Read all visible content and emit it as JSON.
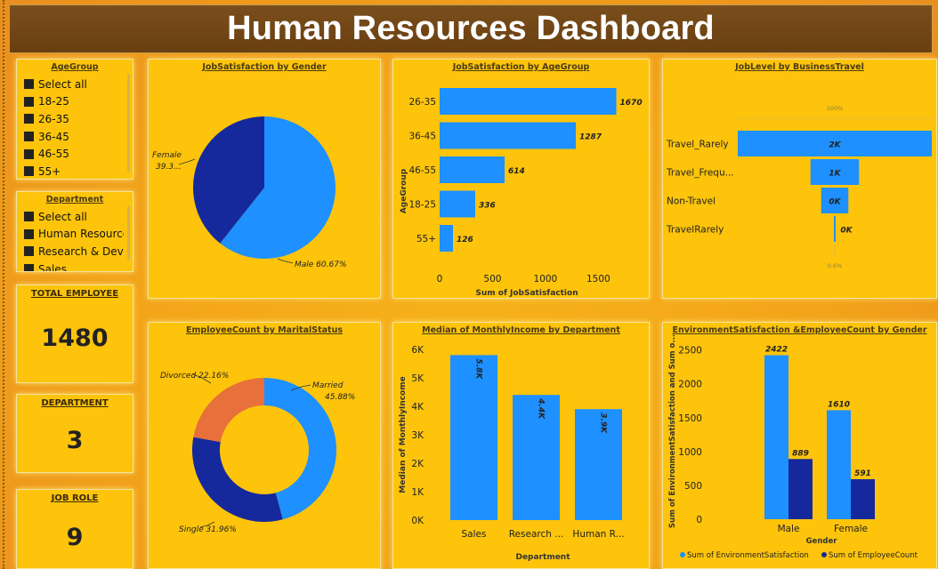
{
  "header": {
    "title": "Human Resources Dashboard"
  },
  "colors": {
    "blue": "#1e90ff",
    "navy": "#15299c",
    "orange": "#e8703a",
    "panel": "#fdc40b",
    "header": "#6e4416"
  },
  "slicers": {
    "age_group": {
      "title": "AgeGroup",
      "items": [
        "Select all",
        "18-25",
        "26-35",
        "36-45",
        "46-55",
        "55+"
      ]
    },
    "department": {
      "title": "Department",
      "items": [
        "Select all",
        "Human Resources",
        "Research & Deve...",
        "Sales"
      ]
    }
  },
  "cards": {
    "total_employee": {
      "title": "TOTAL EMPLOYEE",
      "value": "1480"
    },
    "department": {
      "title": "DEPARTMENT",
      "value": "3"
    },
    "job_role": {
      "title": "JOB ROLE",
      "value": "9"
    }
  },
  "chart_data": [
    {
      "id": "job_sat_gender",
      "type": "pie",
      "title": "JobSatisfaction by Gender",
      "slices": [
        {
          "name": "Male",
          "value": 60.67,
          "label": "Male 60.67%",
          "color": "#1e90ff"
        },
        {
          "name": "Female",
          "value": 39.33,
          "label": "Female 39.3...",
          "color": "#15299c"
        }
      ]
    },
    {
      "id": "job_sat_age",
      "type": "bar",
      "orientation": "horizontal",
      "title": "JobSatisfaction by AgeGroup",
      "ylabel": "AgeGroup",
      "xlabel": "Sum of JobSatisfaction",
      "categories": [
        "26-35",
        "36-45",
        "46-55",
        "18-25",
        "55+"
      ],
      "values": [
        1670,
        1287,
        614,
        336,
        126
      ],
      "data_labels": [
        "1670",
        "1287",
        "614",
        "336",
        "126"
      ],
      "xlim": [
        0,
        1800
      ],
      "xticks": [
        0,
        500,
        1000,
        1500
      ],
      "xtick_labels": [
        "0",
        "500",
        "1000",
        "1500"
      ]
    },
    {
      "id": "job_level_travel",
      "type": "funnel",
      "title": "JobLevel by BusinessTravel",
      "categories": [
        "Travel_Rarely",
        "Travel_Frequ...",
        "Non-Travel",
        "TravelRarely"
      ],
      "values": [
        2000,
        500,
        280,
        12
      ],
      "data_labels": [
        "2K",
        "1K",
        "0K",
        "0K"
      ],
      "top_percent_label": "100%",
      "bottom_percent_label": "0.6%"
    },
    {
      "id": "emp_marital",
      "type": "pie",
      "donut": true,
      "title": "EmployeeCount by MaritalStatus",
      "slices": [
        {
          "name": "Married",
          "value": 45.88,
          "label_line1": "Married",
          "label_line2": "45.88%",
          "color": "#1e90ff"
        },
        {
          "name": "Single",
          "value": 31.96,
          "label": "Single 31.96%",
          "color": "#15299c"
        },
        {
          "name": "Divorced",
          "value": 22.16,
          "label": "Divorced 22.16%",
          "color": "#e8703a"
        }
      ]
    },
    {
      "id": "income_dept",
      "type": "bar",
      "title": "Median of MonthlyIncome by Department",
      "ylabel": "Median of MonthlyIncome",
      "xlabel": "Department",
      "categories": [
        "Sales",
        "Research ...",
        "Human R..."
      ],
      "values": [
        5800,
        4400,
        3900
      ],
      "data_labels": [
        "5.8K",
        "4.4K",
        "3.9K"
      ],
      "ylim": [
        0,
        6000
      ],
      "yticks": [
        0,
        1000,
        2000,
        3000,
        4000,
        5000,
        6000
      ],
      "ytick_labels": [
        "0K",
        "1K",
        "2K",
        "3K",
        "4K",
        "5K",
        "6K"
      ]
    },
    {
      "id": "env_gender",
      "type": "bar",
      "title": "EnvironmentSatisfaction &EmployeeCount by Gender",
      "ylabel": "Sum of EnvironmentSatisfaction and Sum o...",
      "xlabel": "Gender",
      "categories": [
        "Male",
        "Female"
      ],
      "series": [
        {
          "name": "Sum of EnvironmentSatisfaction",
          "values": [
            2422,
            1610
          ],
          "color": "#1e90ff"
        },
        {
          "name": "Sum of EmployeeCount",
          "values": [
            889,
            591
          ],
          "color": "#15299c"
        }
      ],
      "ylim": [
        0,
        2600
      ],
      "yticks": [
        0,
        500,
        1000,
        1500,
        2000,
        2500
      ],
      "ytick_labels": [
        "0",
        "500",
        "1000",
        "1500",
        "2000",
        "2500"
      ],
      "legend": "bottom"
    }
  ]
}
